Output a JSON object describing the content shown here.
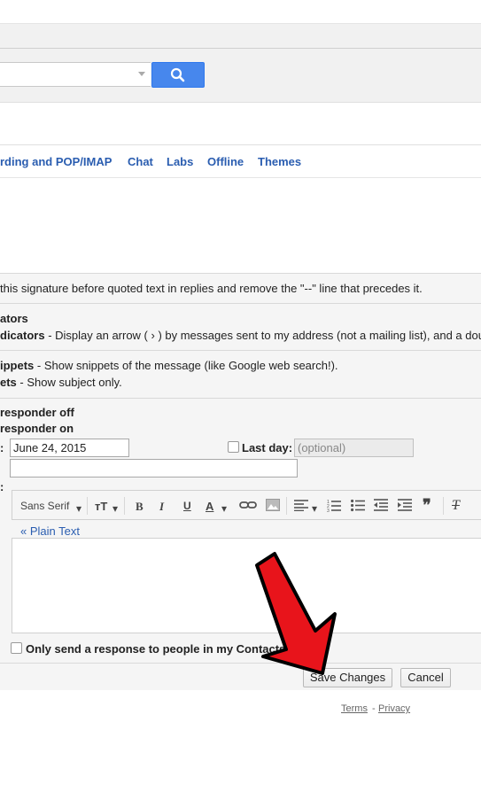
{
  "search": {
    "value": "",
    "button_icon": "search-icon"
  },
  "tabs": [
    {
      "label": "rding and POP/IMAP"
    },
    {
      "label": "Chat"
    },
    {
      "label": "Labs"
    },
    {
      "label": "Offline"
    },
    {
      "label": "Themes"
    }
  ],
  "signature": {
    "text": " this signature before quoted text in replies and remove the \"--\" line that precedes it."
  },
  "indicators": {
    "heading": "ators",
    "option_bold": "dicators",
    "option_text": " - Display an arrow ( › ) by messages sent to my address (not a mailing list), and a doub"
  },
  "snippets": {
    "show_bold": "ippets",
    "show_text": " - Show snippets of the message (like Google web search!).",
    "noshow_bold": "ets",
    "noshow_text": " - Show subject only."
  },
  "vacation": {
    "off_label": "responder off",
    "on_label": "responder on",
    "first_day_colon": ":",
    "first_day_value": "June 24, 2015",
    "last_day_label": "Last day:",
    "last_day_placeholder": "(optional)",
    "subject_value": "",
    "message_colon": ":",
    "plain_text_link": "« Plain Text",
    "contacts_only_label": "Only send a response to people in my Contacts"
  },
  "editor_toolbar": {
    "font": "Sans Serif",
    "bold": "B",
    "italic": "I",
    "underline": "U",
    "text_color": "A",
    "quote": "❞",
    "remove_format": "T"
  },
  "buttons": {
    "save": "Save Changes",
    "cancel": "Cancel"
  },
  "footer": {
    "terms": "Terms",
    "separator": "-",
    "privacy": "Privacy"
  },
  "colors": {
    "link": "#2a5db0",
    "search_button": "#4787ed",
    "arrow": "#e8141b"
  }
}
